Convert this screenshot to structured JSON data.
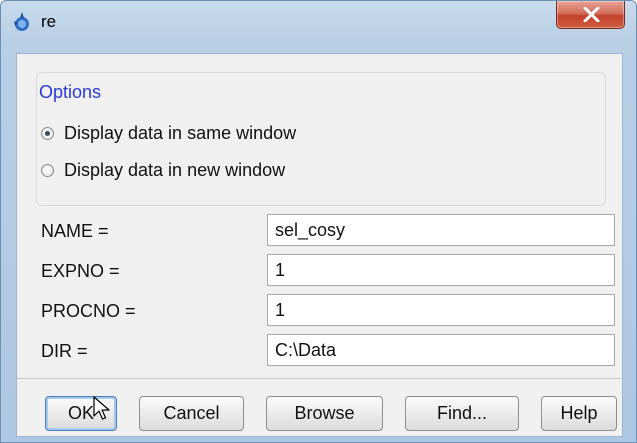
{
  "window": {
    "title": "re",
    "icon": "topspin-app-icon",
    "close_icon": "close-icon",
    "accent_colors": {
      "close": "#c2432b",
      "options_title": "#2a3bd6",
      "frame": "#b9cfe6"
    }
  },
  "options": {
    "title": "Options",
    "radios": [
      {
        "label": "Display data in same window",
        "checked": true
      },
      {
        "label": "Display data in new window",
        "checked": false
      }
    ]
  },
  "fields": [
    {
      "label": "NAME =",
      "value": "sel_cosy"
    },
    {
      "label": "EXPNO =",
      "value": "1"
    },
    {
      "label": "PROCNO =",
      "value": "1"
    },
    {
      "label": "DIR =",
      "value": "C:\\Data"
    }
  ],
  "buttons": {
    "ok": "OK",
    "cancel": "Cancel",
    "browse": "Browse",
    "find": "Find...",
    "help": "Help"
  }
}
